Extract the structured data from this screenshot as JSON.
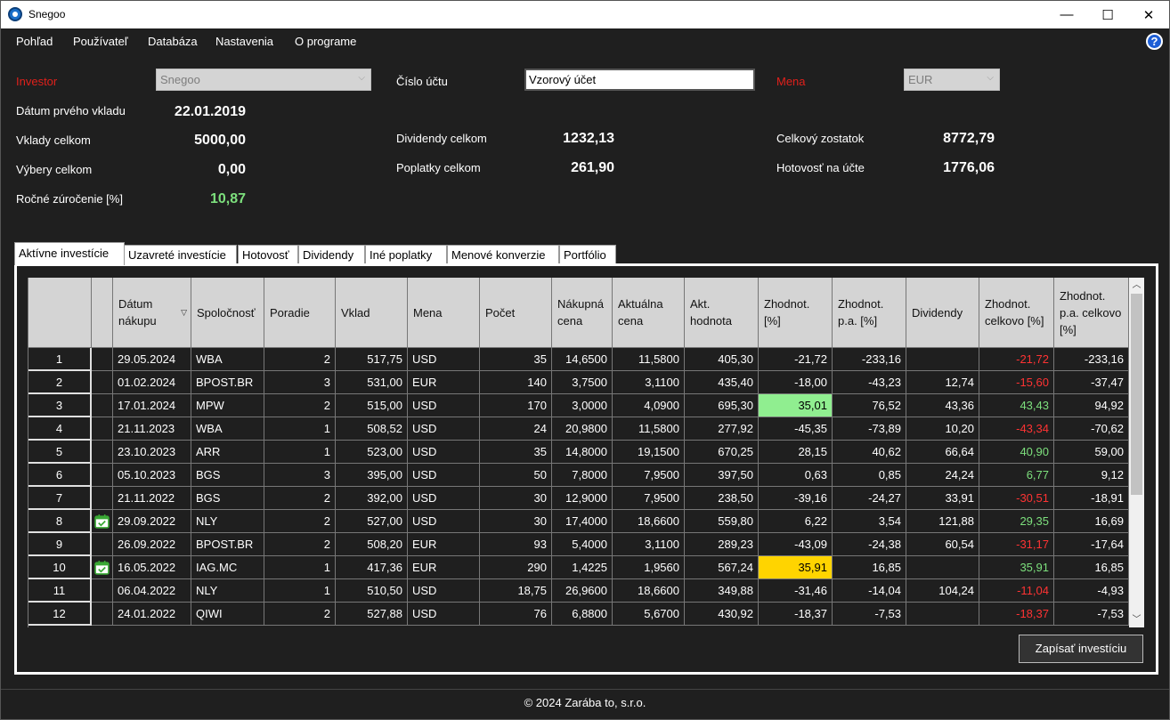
{
  "window": {
    "title": "Snegoo",
    "minimize": "—",
    "maximize": "☐",
    "close": "✕"
  },
  "menu": [
    "Pohľad",
    "Používateľ",
    "Databáza",
    "Nastavenia",
    "O programe"
  ],
  "help": "?",
  "summary": {
    "investor_label": "Investor",
    "investor_value": "Snegoo",
    "account_label": "Číslo účtu",
    "account_value": "Vzorový účet",
    "currency_label": "Mena",
    "currency_value": "EUR",
    "first_deposit_label": "Dátum prvého vkladu",
    "first_deposit_value": "22.01.2019",
    "deposits_label": "Vklady celkom",
    "deposits_value": "5000,00",
    "withdrawals_label": "Výbery celkom",
    "withdrawals_value": "0,00",
    "annual_label": "Ročné zúročenie [%]",
    "annual_value": "10,87",
    "dividends_label": "Dividendy celkom",
    "dividends_value": "1232,13",
    "fees_label": "Poplatky celkom",
    "fees_value": "261,90",
    "balance_label": "Celkový zostatok",
    "balance_value": "8772,79",
    "cash_label": "Hotovosť na účte",
    "cash_value": "1776,06"
  },
  "tabs": [
    "Aktívne investície",
    "Uzavreté investície",
    "Hotovosť",
    "Dividendy",
    "Iné poplatky",
    "Menové konverzie",
    "Portfólio"
  ],
  "columns": [
    "Dátum nákupu",
    "Spoločnosť",
    "Poradie",
    "Vklad",
    "Mena",
    "Počet",
    "Nákupná cena",
    "Aktuálna cena",
    "Akt. hodnota",
    "Zhodnot. [%]",
    "Zhodnot. p.a. [%]",
    "Dividendy",
    "Zhodnot. celkovo [%]",
    "Zhodnot. p.a. celkovo [%]"
  ],
  "rows": [
    {
      "n": "1",
      "icon": "",
      "date": "29.05.2024",
      "company": "WBA",
      "order": "2",
      "deposit": "517,75",
      "cur": "USD",
      "count": "35",
      "buy": "14,6500",
      "cur_price": "11,5800",
      "value": "405,30",
      "ret": "-21,72",
      "ret_pa": "-233,16",
      "div": "",
      "ret_total": "-21,72",
      "ret_pa_total": "-233,16",
      "ret_hl": "",
      "total_color": "neg"
    },
    {
      "n": "2",
      "icon": "",
      "date": "01.02.2024",
      "company": "BPOST.BR",
      "order": "3",
      "deposit": "531,00",
      "cur": "EUR",
      "count": "140",
      "buy": "3,7500",
      "cur_price": "3,1100",
      "value": "435,40",
      "ret": "-18,00",
      "ret_pa": "-43,23",
      "div": "12,74",
      "ret_total": "-15,60",
      "ret_pa_total": "-37,47",
      "ret_hl": "",
      "total_color": "neg"
    },
    {
      "n": "3",
      "icon": "",
      "date": "17.01.2024",
      "company": "MPW",
      "order": "2",
      "deposit": "515,00",
      "cur": "USD",
      "count": "170",
      "buy": "3,0000",
      "cur_price": "4,0900",
      "value": "695,30",
      "ret": "35,01",
      "ret_pa": "76,52",
      "div": "43,36",
      "ret_total": "43,43",
      "ret_pa_total": "94,92",
      "ret_hl": "hl-green",
      "total_color": "pos"
    },
    {
      "n": "4",
      "icon": "",
      "date": "21.11.2023",
      "company": "WBA",
      "order": "1",
      "deposit": "508,52",
      "cur": "USD",
      "count": "24",
      "buy": "20,9800",
      "cur_price": "11,5800",
      "value": "277,92",
      "ret": "-45,35",
      "ret_pa": "-73,89",
      "div": "10,20",
      "ret_total": "-43,34",
      "ret_pa_total": "-70,62",
      "ret_hl": "",
      "total_color": "neg"
    },
    {
      "n": "5",
      "icon": "",
      "date": "23.10.2023",
      "company": "ARR",
      "order": "1",
      "deposit": "523,00",
      "cur": "USD",
      "count": "35",
      "buy": "14,8000",
      "cur_price": "19,1500",
      "value": "670,25",
      "ret": "28,15",
      "ret_pa": "40,62",
      "div": "66,64",
      "ret_total": "40,90",
      "ret_pa_total": "59,00",
      "ret_hl": "",
      "total_color": "pos"
    },
    {
      "n": "6",
      "icon": "",
      "date": "05.10.2023",
      "company": "BGS",
      "order": "3",
      "deposit": "395,00",
      "cur": "USD",
      "count": "50",
      "buy": "7,8000",
      "cur_price": "7,9500",
      "value": "397,50",
      "ret": "0,63",
      "ret_pa": "0,85",
      "div": "24,24",
      "ret_total": "6,77",
      "ret_pa_total": "9,12",
      "ret_hl": "",
      "total_color": "pos"
    },
    {
      "n": "7",
      "icon": "",
      "date": "21.11.2022",
      "company": "BGS",
      "order": "2",
      "deposit": "392,00",
      "cur": "USD",
      "count": "30",
      "buy": "12,9000",
      "cur_price": "7,9500",
      "value": "238,50",
      "ret": "-39,16",
      "ret_pa": "-24,27",
      "div": "33,91",
      "ret_total": "-30,51",
      "ret_pa_total": "-18,91",
      "ret_hl": "",
      "total_color": "neg"
    },
    {
      "n": "8",
      "icon": "calendar-check",
      "date": "29.09.2022",
      "company": "NLY",
      "order": "2",
      "deposit": "527,00",
      "cur": "USD",
      "count": "30",
      "buy": "17,4000",
      "cur_price": "18,6600",
      "value": "559,80",
      "ret": "6,22",
      "ret_pa": "3,54",
      "div": "121,88",
      "ret_total": "29,35",
      "ret_pa_total": "16,69",
      "ret_hl": "",
      "total_color": "pos"
    },
    {
      "n": "9",
      "icon": "",
      "date": "26.09.2022",
      "company": "BPOST.BR",
      "order": "2",
      "deposit": "508,20",
      "cur": "EUR",
      "count": "93",
      "buy": "5,4000",
      "cur_price": "3,1100",
      "value": "289,23",
      "ret": "-43,09",
      "ret_pa": "-24,38",
      "div": "60,54",
      "ret_total": "-31,17",
      "ret_pa_total": "-17,64",
      "ret_hl": "",
      "total_color": "neg"
    },
    {
      "n": "10",
      "icon": "calendar-check",
      "date": "16.05.2022",
      "company": "IAG.MC",
      "order": "1",
      "deposit": "417,36",
      "cur": "EUR",
      "count": "290",
      "buy": "1,4225",
      "cur_price": "1,9560",
      "value": "567,24",
      "ret": "35,91",
      "ret_pa": "16,85",
      "div": "",
      "ret_total": "35,91",
      "ret_pa_total": "16,85",
      "ret_hl": "hl-yellow",
      "total_color": "pos"
    },
    {
      "n": "11",
      "icon": "",
      "date": "06.04.2022",
      "company": "NLY",
      "order": "1",
      "deposit": "510,50",
      "cur": "USD",
      "count": "18,75",
      "buy": "26,9600",
      "cur_price": "18,6600",
      "value": "349,88",
      "ret": "-31,46",
      "ret_pa": "-14,04",
      "div": "104,24",
      "ret_total": "-11,04",
      "ret_pa_total": "-4,93",
      "ret_hl": "",
      "total_color": "neg"
    },
    {
      "n": "12",
      "icon": "",
      "date": "24.01.2022",
      "company": "QIWI",
      "order": "2",
      "deposit": "527,88",
      "cur": "USD",
      "count": "76",
      "buy": "6,8800",
      "cur_price": "5,6700",
      "value": "430,92",
      "ret": "-18,37",
      "ret_pa": "-7,53",
      "div": "",
      "ret_total": "-18,37",
      "ret_pa_total": "-7,53",
      "ret_hl": "",
      "total_color": "neg"
    }
  ],
  "save_button": "Zapísať investíciu",
  "footer": "© 2024 Zarába to, s.r.o.",
  "colors": {
    "negative": "#ff3333",
    "positive": "#7de07d",
    "highlight_green": "#90ee90",
    "highlight_yellow": "#ffd400",
    "label_red": "#e0201b"
  }
}
